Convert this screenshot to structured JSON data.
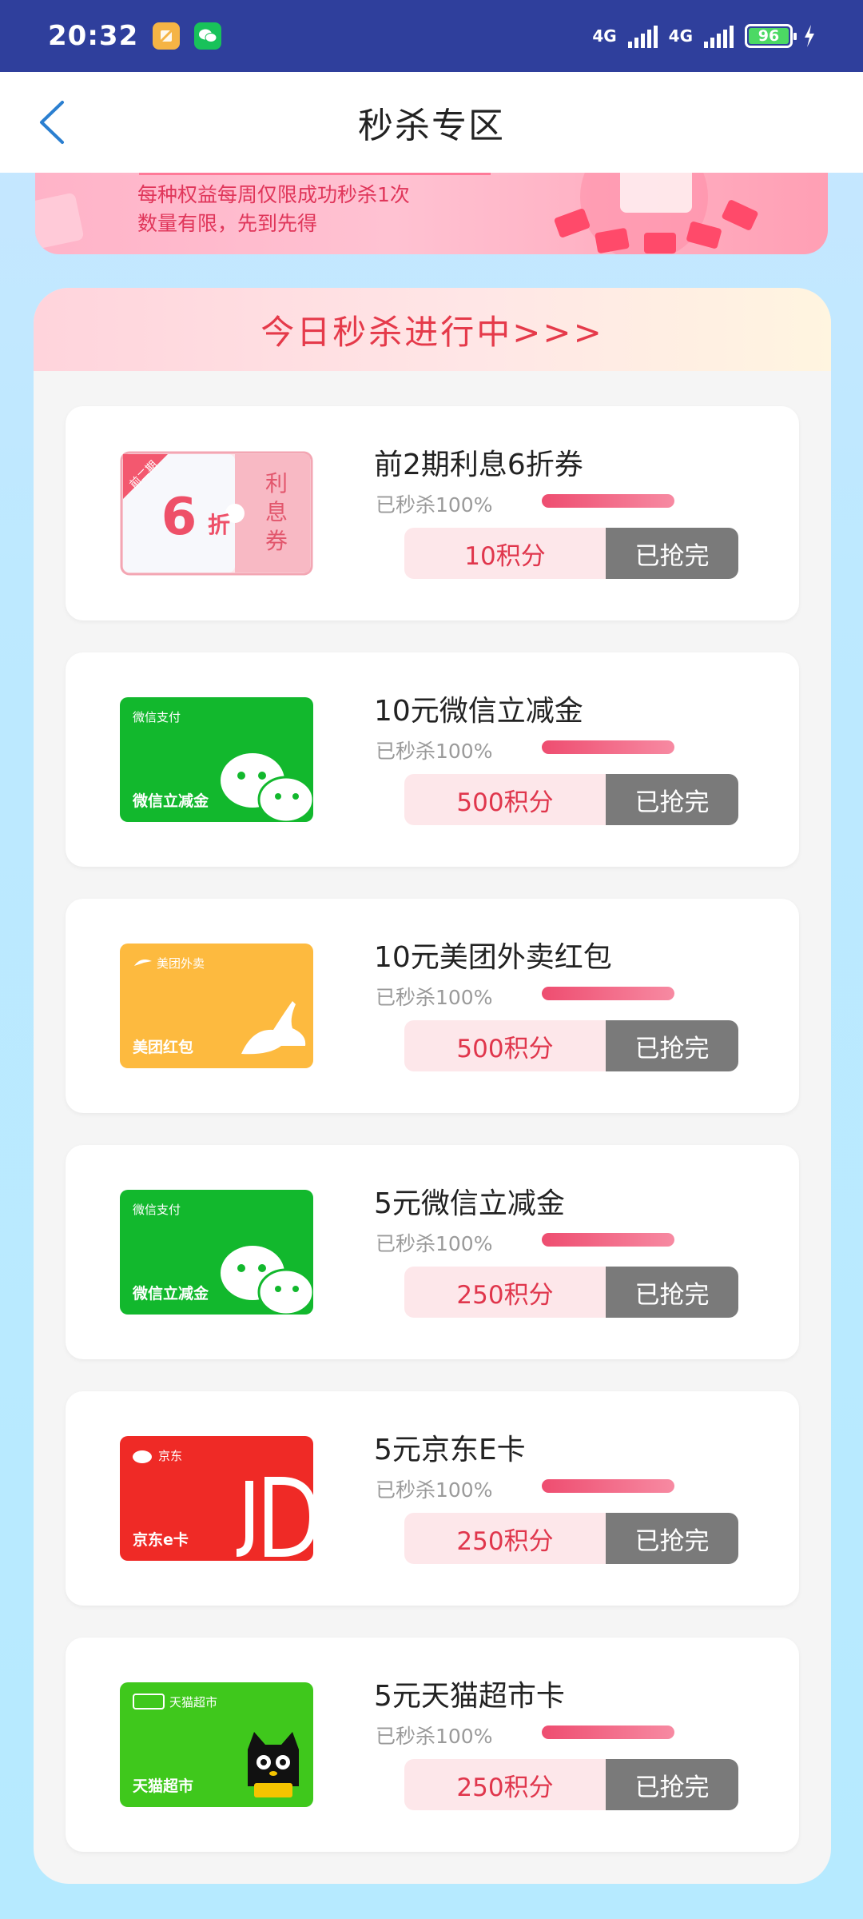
{
  "status": {
    "time": "20:32",
    "net1": "4G",
    "net2": "4G",
    "battery": "96"
  },
  "nav": {
    "title": "秒杀专区"
  },
  "banner": {
    "line1": "每种权益每周仅限成功秒杀1次",
    "line2": "数量有限，先到先得"
  },
  "section": {
    "header": "今日秒杀进行中>>>"
  },
  "items": [
    {
      "name": "前2期利息6折券",
      "sold": "已秒杀100%",
      "progress": 1.0,
      "price": "10积分",
      "status": "已抢完",
      "thumb": {
        "type": "coupon",
        "ribbon": "前二期",
        "discount": "6",
        "unit": "折",
        "side": [
          "利",
          "息",
          "券"
        ]
      }
    },
    {
      "name": "10元微信立减金",
      "sold": "已秒杀100%",
      "progress": 1.0,
      "price": "500积分",
      "status": "已抢完",
      "thumb": {
        "type": "wechat",
        "brand": "微信支付",
        "label": "微信立减金"
      }
    },
    {
      "name": "10元美团外卖红包",
      "sold": "已秒杀100%",
      "progress": 1.0,
      "price": "500积分",
      "status": "已抢完",
      "thumb": {
        "type": "meituan",
        "brand": "美团外卖",
        "label": "美团红包"
      }
    },
    {
      "name": "5元微信立减金",
      "sold": "已秒杀100%",
      "progress": 1.0,
      "price": "250积分",
      "status": "已抢完",
      "thumb": {
        "type": "wechat",
        "brand": "微信支付",
        "label": "微信立减金"
      }
    },
    {
      "name": "5元京东E卡",
      "sold": "已秒杀100%",
      "progress": 1.0,
      "price": "250积分",
      "status": "已抢完",
      "thumb": {
        "type": "jd",
        "brand": "京东",
        "label": "京东e卡"
      }
    },
    {
      "name": "5元天猫超市卡",
      "sold": "已秒杀100%",
      "progress": 1.0,
      "price": "250积分",
      "status": "已抢完",
      "thumb": {
        "type": "tmall",
        "brand": "天猫超市",
        "label": "天猫超市"
      }
    }
  ]
}
